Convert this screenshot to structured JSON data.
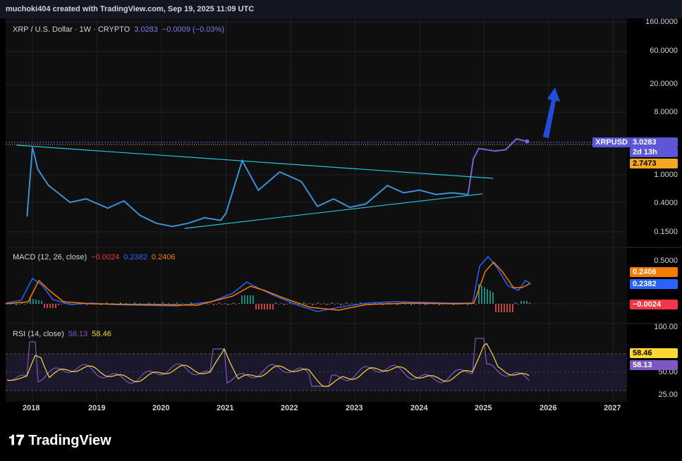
{
  "header": {
    "attribution": "muchoki404 created with TradingView.com, Sep 19, 2025 11:09 UTC"
  },
  "price": {
    "symbol_line": "XRP / U.S. Dollar · 1W · CRYPTO",
    "last": "3.0283",
    "change": "−0.0009 (−0.03%)",
    "y_ticks": [
      "160.0000",
      "60.0000",
      "20.0000",
      "8.0000",
      "1.0000",
      "0.4000",
      "0.1500"
    ],
    "tag_symbol": "XRPUSD",
    "tag_price": "3.0283",
    "tag_time": "2d 13h",
    "tag_level": "2.7473"
  },
  "macd": {
    "title": "MACD (12, 26, close)",
    "hist": "−0.0024",
    "macd": "0.2382",
    "signal": "0.2406",
    "y_ticks": [
      "0.5000"
    ],
    "tag_signal": "0.2406",
    "tag_macd": "0.2382",
    "tag_hist": "−0.0024"
  },
  "rsi": {
    "title": "RSI (14, close)",
    "rsi": "58.13",
    "ma": "58.46",
    "y_ticks": [
      "100.00",
      "50.00",
      "25.00"
    ],
    "tag_ma": "58.46",
    "tag_rsi": "58.13"
  },
  "x_ticks": [
    "2018",
    "2019",
    "2020",
    "2021",
    "2022",
    "2023",
    "2024",
    "2025",
    "2026",
    "2027"
  ],
  "footer": {
    "brand": "TradingView"
  },
  "colors": {
    "price": "#3d8fd6",
    "recent": "#6c68e0",
    "trend": "#26c6da",
    "arrow": "#1f4fd8",
    "macd": "#2962ff",
    "signal": "#f57c00",
    "rsi": "#7e57c2",
    "rsi_ma": "#fdd835"
  },
  "chart_data": {
    "type": "line",
    "x": [
      "2017-12",
      "2018-01",
      "2018-02",
      "2018-04",
      "2018-08",
      "2018-11",
      "2019-03",
      "2019-06",
      "2019-09",
      "2019-12",
      "2020-03",
      "2020-06",
      "2020-09",
      "2020-12",
      "2021-01",
      "2021-04",
      "2021-07",
      "2021-11",
      "2022-03",
      "2022-06",
      "2022-09",
      "2022-12",
      "2023-03",
      "2023-07",
      "2023-10",
      "2024-01",
      "2024-04",
      "2024-07",
      "2024-10",
      "2024-11",
      "2024-12",
      "2025-03",
      "2025-05",
      "2025-07",
      "2025-09"
    ],
    "series": [
      {
        "name": "XRPUSD",
        "values": [
          0.25,
          2.5,
          1.2,
          0.7,
          0.4,
          0.45,
          0.33,
          0.42,
          0.26,
          0.2,
          0.18,
          0.2,
          0.24,
          0.22,
          0.28,
          1.6,
          0.6,
          1.1,
          0.8,
          0.35,
          0.45,
          0.34,
          0.38,
          0.7,
          0.55,
          0.6,
          0.52,
          0.55,
          0.52,
          1.7,
          2.4,
          2.2,
          2.3,
          3.3,
          3.03
        ]
      }
    ],
    "ylim": [
      0.1,
      160
    ],
    "log_scale": true
  }
}
